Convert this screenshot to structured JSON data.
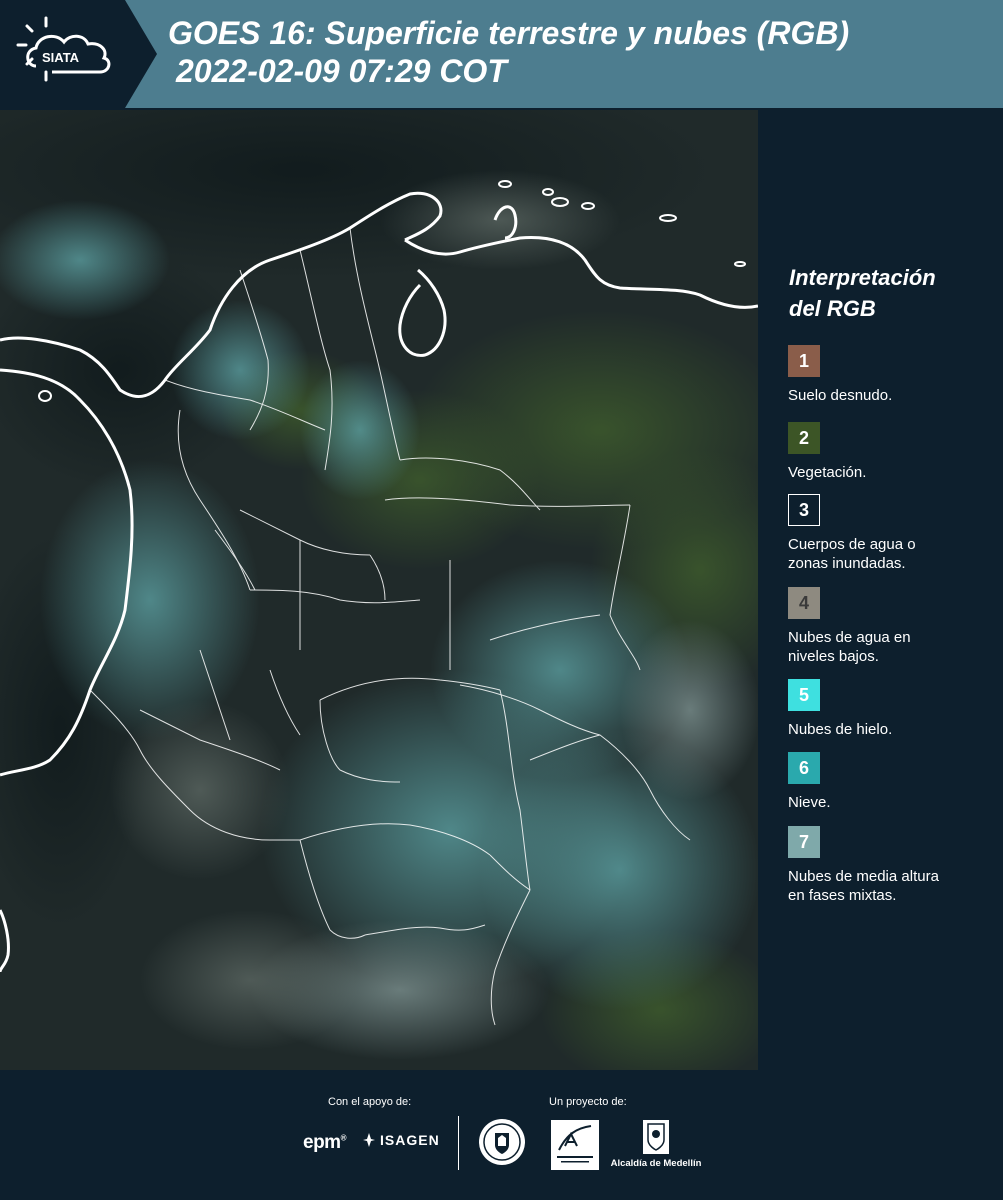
{
  "header": {
    "logo_text": "SIATA",
    "title_line1": "GOES 16: Superficie terrestre y nubes (RGB)",
    "title_line2": "2022-02-09 07:29 COT"
  },
  "legend": {
    "title_line1": "Interpretación",
    "title_line2": "del RGB",
    "items": [
      {
        "number": "1",
        "color": "#8a5d4a",
        "text_line1": "Suelo desnudo.",
        "text_line2": ""
      },
      {
        "number": "2",
        "color": "#3c5526",
        "text_line1": "Vegetación.",
        "text_line2": ""
      },
      {
        "number": "3",
        "color": "#0d1f2d",
        "text_line1": "Cuerpos de agua o",
        "text_line2": "zonas inundadas."
      },
      {
        "number": "4",
        "color": "#8e8a80",
        "text_line1": "Nubes de agua en",
        "text_line2": "niveles bajos."
      },
      {
        "number": "5",
        "color": "#3ee0e0",
        "text_line1": "Nubes de hielo.",
        "text_line2": ""
      },
      {
        "number": "6",
        "color": "#2aa9ad",
        "text_line1": "Nieve.",
        "text_line2": ""
      },
      {
        "number": "7",
        "color": "#7fa9aa",
        "text_line1": "Nubes de media altura",
        "text_line2": "en fases mixtas."
      }
    ]
  },
  "footer": {
    "support_label": "Con el apoyo de:",
    "project_label": "Un proyecto de:",
    "epm_text": "epm",
    "isagen_text": "ISAGEN",
    "alcaldia_text": "Alcaldía de Medellín"
  },
  "colors": {
    "header_bg": "#4d7d8f",
    "page_bg": "#0d1f2d",
    "border_white": "#ffffff"
  }
}
